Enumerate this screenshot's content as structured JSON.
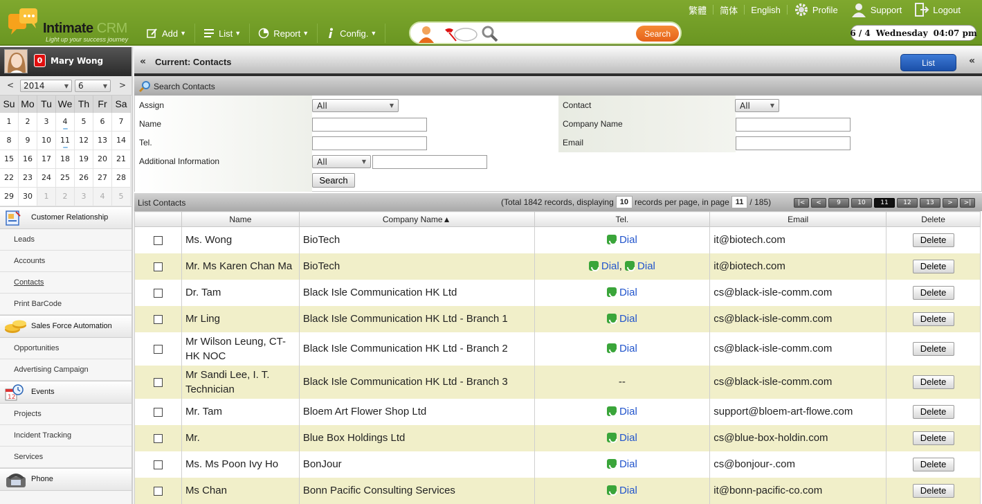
{
  "app": {
    "logo_main": "Intimate",
    "logo_crm": "CRM",
    "logo_tagline": "Light up your success journey"
  },
  "topnav": {
    "links": [
      "繁體",
      "简体",
      "English"
    ],
    "profile": "Profile",
    "support": "Support",
    "logout": "Logout",
    "menu": [
      {
        "label": "Add",
        "icon": "add-icon"
      },
      {
        "label": "List",
        "icon": "list-icon"
      },
      {
        "label": "Report",
        "icon": "report-icon"
      },
      {
        "label": "Config.",
        "icon": "info-icon"
      }
    ],
    "search_button": "Search",
    "search_value": "",
    "date": {
      "day": "6 / 4",
      "weekday": "Wednesday",
      "time": "04:07 pm"
    }
  },
  "user": {
    "name": "Mary Wong",
    "notifications": "0"
  },
  "calendar": {
    "prev": "<",
    "next": ">",
    "year": "2014",
    "month": "6",
    "weekdays": [
      "Su",
      "Mo",
      "Tu",
      "We",
      "Th",
      "Fr",
      "Sa"
    ],
    "days": [
      {
        "d": "1"
      },
      {
        "d": "2"
      },
      {
        "d": "3"
      },
      {
        "d": "4",
        "mark": true
      },
      {
        "d": "5"
      },
      {
        "d": "6"
      },
      {
        "d": "7"
      },
      {
        "d": "8"
      },
      {
        "d": "9"
      },
      {
        "d": "10"
      },
      {
        "d": "11",
        "mark": true
      },
      {
        "d": "12"
      },
      {
        "d": "13"
      },
      {
        "d": "14"
      },
      {
        "d": "15"
      },
      {
        "d": "16"
      },
      {
        "d": "17"
      },
      {
        "d": "18"
      },
      {
        "d": "19"
      },
      {
        "d": "20"
      },
      {
        "d": "21"
      },
      {
        "d": "22"
      },
      {
        "d": "23"
      },
      {
        "d": "24"
      },
      {
        "d": "25"
      },
      {
        "d": "26"
      },
      {
        "d": "27"
      },
      {
        "d": "28"
      },
      {
        "d": "29"
      },
      {
        "d": "30"
      },
      {
        "d": "1",
        "other": true
      },
      {
        "d": "2",
        "other": true
      },
      {
        "d": "3",
        "other": true
      },
      {
        "d": "4",
        "other": true
      },
      {
        "d": "5",
        "other": true
      }
    ]
  },
  "sidebar": {
    "sections": [
      {
        "label": "Customer Relationship",
        "icon": "customer-relationship-icon",
        "links": [
          "Leads",
          "Accounts",
          "Contacts",
          "Print BarCode"
        ]
      },
      {
        "label": "Sales Force Automation",
        "icon": "coins-icon",
        "links": [
          "Opportunities",
          "Advertising Campaign"
        ]
      },
      {
        "label": "Events",
        "icon": "calendar-clock-icon",
        "links": [
          "Projects",
          "Incident Tracking",
          "Services"
        ]
      },
      {
        "label": "Phone",
        "icon": "telephone-icon",
        "links": []
      }
    ],
    "active_link": "Contacts"
  },
  "main": {
    "current_title": "Current: Contacts",
    "list_button": "List",
    "search_title": "Search Contacts",
    "search": {
      "assign_label": "Assign",
      "assign_value": "All",
      "name_label": "Name",
      "tel_label": "Tel.",
      "additional_label": "Additional Information",
      "additional_value": "All",
      "contact_label": "Contact",
      "contact_value": "All",
      "company_label": "Company Name",
      "email_label": "Email",
      "search_button": "Search"
    },
    "list_title": "List Contacts",
    "pager": {
      "prefix": "(Total 1842 records, displaying",
      "per_page": "10",
      "middle": "records per page, in page",
      "page": "11",
      "suffix": "/ 185)",
      "buttons": [
        "|<",
        "<",
        "9",
        "10",
        "11",
        "12",
        "13",
        ">",
        ">|"
      ],
      "current": "11"
    },
    "columns": [
      "",
      "Name",
      "Company Name▲",
      "Tel.",
      "Email",
      "Delete"
    ],
    "rows": [
      {
        "name": "Ms. Wong",
        "company": "BioTech",
        "tel": [
          "Dial"
        ],
        "email": "it@biotech.com"
      },
      {
        "name": "Mr. Ms Karen Chan Ma",
        "company": "BioTech",
        "tel": [
          "Dial",
          "Dial"
        ],
        "email": "it@biotech.com"
      },
      {
        "name": "Dr. Tam",
        "company": "Black Isle Communication HK Ltd",
        "tel": [
          "Dial"
        ],
        "email": "cs@black-isle-comm.com"
      },
      {
        "name": "Mr Ling",
        "company": "Black Isle Communication HK Ltd - Branch 1",
        "tel": [
          "Dial"
        ],
        "email": "cs@black-isle-comm.com"
      },
      {
        "name": "Mr Wilson Leung, CT-HK NOC",
        "company": "Black Isle Communication HK Ltd - Branch 2",
        "tel": [
          "Dial"
        ],
        "email": "cs@black-isle-comm.com",
        "tall": true
      },
      {
        "name": "Mr Sandi Lee, I. T. Technician",
        "company": "Black Isle Communication HK Ltd - Branch 3",
        "tel": [],
        "tel_text": "--",
        "email": "cs@black-isle-comm.com",
        "tall": true
      },
      {
        "name": "Mr. Tam",
        "company": "Bloem Art Flower Shop Ltd",
        "tel": [
          "Dial"
        ],
        "email": "support@bloem-art-flowe.com"
      },
      {
        "name": "Mr.",
        "company": "Blue Box Holdings Ltd",
        "tel": [
          "Dial"
        ],
        "email": "cs@blue-box-holdin.com"
      },
      {
        "name": "Ms. Ms Poon Ivy Ho",
        "company": "BonJour",
        "tel": [
          "Dial"
        ],
        "email": "cs@bonjour-.com"
      },
      {
        "name": "Ms Chan",
        "company": "Bonn Pacific Consulting Services",
        "tel": [
          "Dial"
        ],
        "email": "it@bonn-pacific-co.com"
      }
    ],
    "delete_label": "Delete"
  }
}
